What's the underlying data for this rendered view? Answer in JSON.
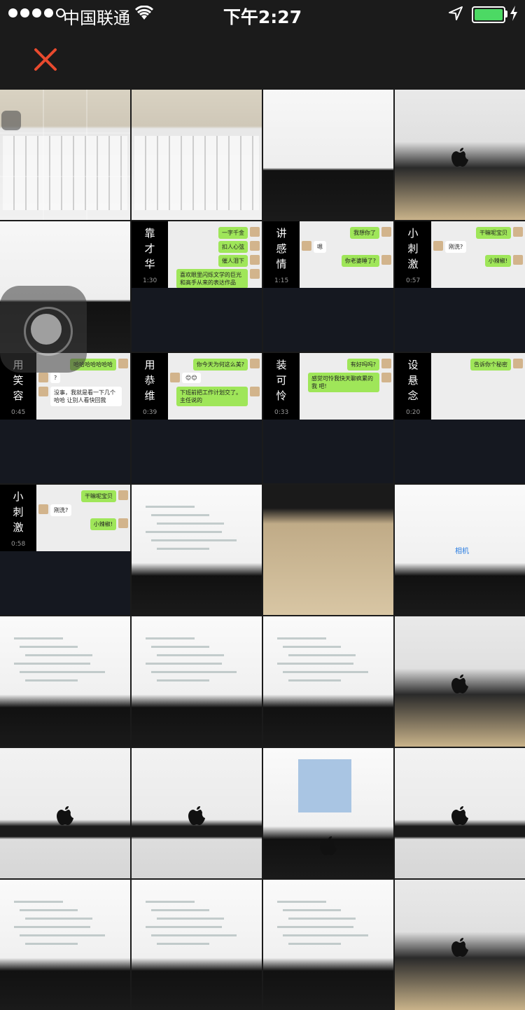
{
  "status_bar": {
    "carrier": "中国联通",
    "time": "下午2:27",
    "battery_level": 1.0,
    "signal_bars_filled": 4,
    "signal_bars_total": 5
  },
  "nav": {
    "close_icon": "close-icon",
    "accent": "#e84a2e"
  },
  "photos": [
    {
      "kind": "keyboard"
    },
    {
      "kind": "keyboard"
    },
    {
      "kind": "screen"
    },
    {
      "kind": "imac"
    },
    {
      "kind": "screen"
    },
    {
      "kind": "chat",
      "title": "靠才华",
      "dur": "1:30",
      "bubbles": [
        {
          "side": "right",
          "text": "一字千金"
        },
        {
          "side": "right",
          "text": "扣人心弦"
        },
        {
          "side": "right",
          "text": "催人泪下"
        },
        {
          "side": "right",
          "text": "喜欢眼里闪烁文学的巨光 和高手从来的表达作品"
        }
      ]
    },
    {
      "kind": "chat",
      "title": "讲感情",
      "dur": "1:15",
      "bubbles": [
        {
          "side": "right",
          "text": "我想你了"
        },
        {
          "side": "left",
          "text": "嗯"
        },
        {
          "side": "right",
          "text": "你老婆睡了?"
        }
      ]
    },
    {
      "kind": "chat",
      "title": "小刺激",
      "dur": "0:57",
      "bubbles": [
        {
          "side": "right",
          "text": "干嘛呢宝贝"
        },
        {
          "side": "left",
          "text": "刚洗?"
        },
        {
          "side": "right",
          "text": "小辣椒!"
        }
      ]
    },
    {
      "kind": "chat",
      "title": "用笑容",
      "dur": "0:45",
      "bubbles": [
        {
          "side": "right",
          "text": "哈哈哈哈哈哈哈"
        },
        {
          "side": "left",
          "text": "?"
        },
        {
          "side": "left",
          "text": "没事，我就是看一下几个哈哈 让别人看快回我"
        }
      ]
    },
    {
      "kind": "chat",
      "title": "用恭维",
      "dur": "0:39",
      "bubbles": [
        {
          "side": "right",
          "text": "你今天为何这么美?"
        },
        {
          "side": "left",
          "text": "😊😊"
        },
        {
          "side": "right",
          "text": "下班前把工作计划交了。主任说的"
        }
      ]
    },
    {
      "kind": "chat",
      "title": "装可怜",
      "dur": "0:33",
      "bubbles": [
        {
          "side": "right",
          "text": "有好吗吗?"
        },
        {
          "side": "right",
          "text": "感觉可怜我快天聊疯累的我 吧!"
        }
      ]
    },
    {
      "kind": "chat",
      "title": "设悬念",
      "dur": "0:20",
      "bubbles": [
        {
          "side": "right",
          "text": "告诉你个秘密"
        }
      ]
    },
    {
      "kind": "chat",
      "title": "小刺激",
      "dur": "0:58",
      "bubbles": [
        {
          "side": "right",
          "text": "干嘛呢宝贝"
        },
        {
          "side": "left",
          "text": "刚洗?"
        },
        {
          "side": "right",
          "text": "小辣椒!"
        }
      ]
    },
    {
      "kind": "code"
    },
    {
      "kind": "desk"
    },
    {
      "kind": "camapp",
      "label": "相机"
    },
    {
      "kind": "code"
    },
    {
      "kind": "code"
    },
    {
      "kind": "code"
    },
    {
      "kind": "imac"
    },
    {
      "kind": "imacscreen"
    },
    {
      "kind": "imacscreen"
    },
    {
      "kind": "bluepanel"
    },
    {
      "kind": "imacscreen"
    },
    {
      "kind": "code"
    },
    {
      "kind": "code"
    },
    {
      "kind": "code"
    },
    {
      "kind": "imac"
    }
  ]
}
